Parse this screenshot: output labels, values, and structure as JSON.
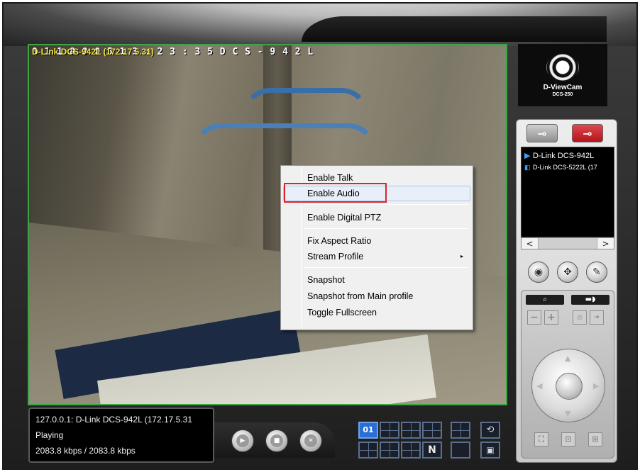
{
  "video": {
    "osd_overlay": "0 1 1 8 0 0 5  1 3 : 2 3 : 3 5   D C S - 9 4 2 L",
    "osd_title": "D-Link DCS-942L (172.17.5.31)"
  },
  "context_menu": {
    "items": [
      {
        "label": "Enable Talk"
      },
      {
        "label": "Enable Audio"
      },
      {
        "label": "Enable Digital PTZ"
      },
      {
        "label": "Fix Aspect Ratio"
      },
      {
        "label": "Stream Profile",
        "submenu_arrow": "▸"
      },
      {
        "label": "Snapshot"
      },
      {
        "label": "Snapshot from Main profile"
      },
      {
        "label": "Toggle Fullscreen"
      }
    ],
    "highlighted": "Enable Audio",
    "highlight_color": "#d8262d"
  },
  "status": {
    "line1": "127.0.0.1: D-Link DCS-942L (172.17.5.31",
    "line2": "Playing",
    "line3": "2083.8 kbps / 2083.8 kbps"
  },
  "layout": {
    "active_label": "01",
    "n_label": "N"
  },
  "logo": {
    "brand": "D-ViewCam",
    "model": "DCS-250"
  },
  "camera_list": {
    "items": [
      {
        "label": "D-Link DCS-942L",
        "marker": "▶"
      },
      {
        "label": "D-Link DCS-5222L (17",
        "marker": "◧"
      }
    ]
  },
  "scroll": {
    "left": "<",
    "right": ">"
  },
  "colors": {
    "video_border": "#3ea446",
    "disconnect_button": "#c8222a",
    "active_layout": "#2a6fd6"
  }
}
